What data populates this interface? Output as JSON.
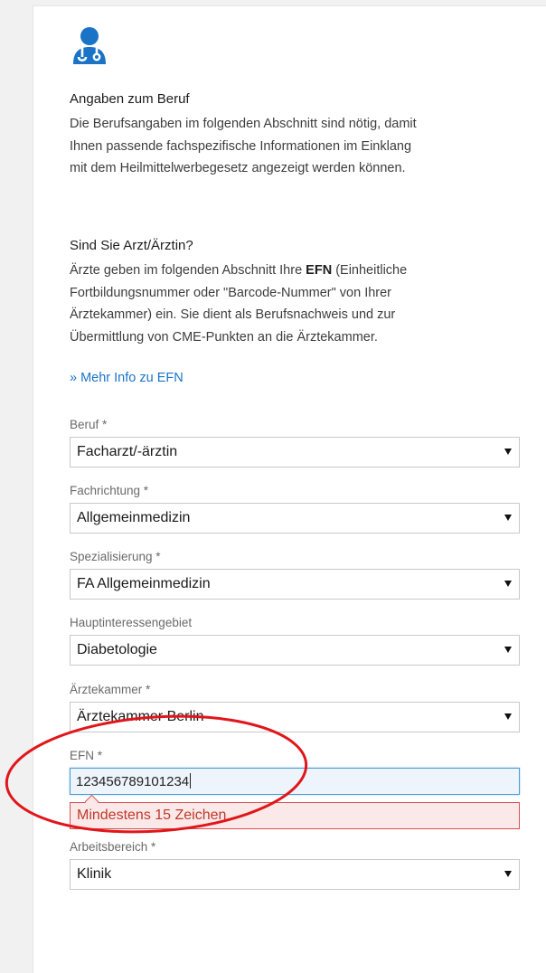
{
  "profession_section": {
    "icon": "doctor-stethoscope-icon",
    "accent_color": "#1a73c6",
    "title": "Angaben zum Beruf",
    "description_lines": [
      "Die Berufsangaben im folgenden Abschnitt sind nötig, damit",
      "Ihnen passende fachspezifische Informationen im Einklang",
      "mit dem Heilmittelwerbegesetz angezeigt werden können."
    ]
  },
  "doctor_section": {
    "title": "Sind Sie Arzt/Ärztin?",
    "line1_before": "Ärzte geben im folgenden Abschnitt Ihre ",
    "line1_bold": "EFN",
    "line1_after": " (Einheitliche",
    "lines": [
      "Fortbildungsnummer oder \"Barcode-Nummer\" von Ihrer",
      "Ärztekammer) ein. Sie dient als Berufsnachweis und zur",
      "Übermittlung von CME-Punkten an die Ärztekammer."
    ],
    "more_info_link": "» Mehr Info zu EFN"
  },
  "form": {
    "beruf": {
      "label": "Beruf *",
      "value": "Facharzt/-ärztin"
    },
    "fachrichtung": {
      "label": "Fachrichtung *",
      "value": "Allgemeinmedizin"
    },
    "spezialisierung": {
      "label": "Spezialisierung *",
      "value": "FA Allgemeinmedizin"
    },
    "hauptinteressengebiet": {
      "label": "Hauptinteressengebiet",
      "value": "Diabetologie"
    },
    "aerztekammer": {
      "label": "Ärztekammer *",
      "value": "Ärztekammer Berlin"
    },
    "efn": {
      "label": "EFN *",
      "value": "123456789101234",
      "error": "Mindestens 15 Zeichen",
      "error_color": "#c0392b"
    },
    "arbeitsbereich": {
      "label": "Arbeitsbereich *",
      "value": "Klinik"
    }
  },
  "annotation": {
    "type": "red-ellipse-highlight",
    "color": "#e0161b"
  }
}
